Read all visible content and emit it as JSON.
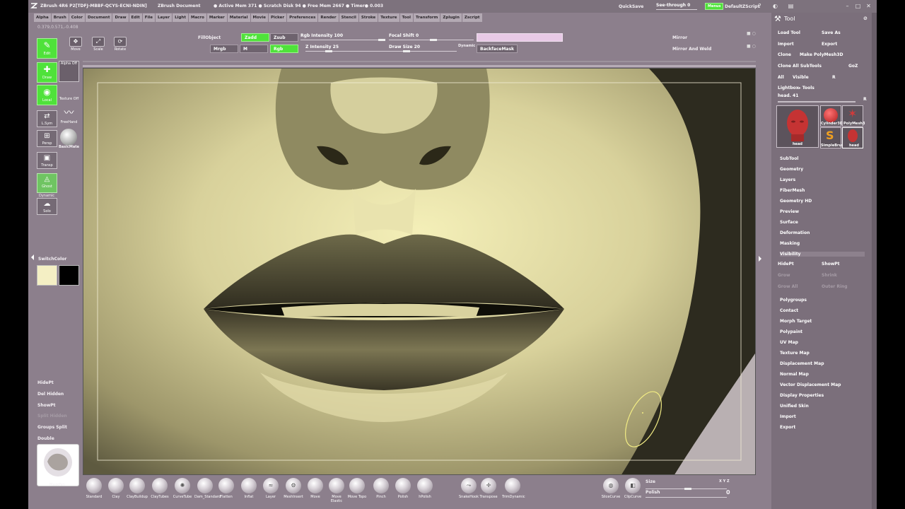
{
  "title": {
    "app": "ZBrush 4R6 P2[TDFJ-MBBF-QCYS-ECNI-NDIN]",
    "document": "ZBrush Document",
    "stats": "● Active Mem 371 ● Scratch Disk 94 ● Free Mem 2667 ● Timer● 0.003",
    "quicksave": "QuickSave",
    "see_through": "See-through  0",
    "menus_btn": "Menus",
    "default_script": "DefaultZScript"
  },
  "menu": [
    "Alpha",
    "Brush",
    "Color",
    "Document",
    "Draw",
    "Edit",
    "File",
    "Layer",
    "Light",
    "Macro",
    "Marker",
    "Material",
    "Movie",
    "Picker",
    "Preferences",
    "Render",
    "Stencil",
    "Stroke",
    "Texture",
    "Tool",
    "Transform",
    "Zplugin",
    "Zscript"
  ],
  "coords": "0.379,0.571,-0.408",
  "shelf": {
    "edit": "Edit",
    "move": "Move",
    "scale": "Scale",
    "rotate": "Rotate",
    "fill_object": "FillObject",
    "mrgb": "Mrgb",
    "m": "M",
    "rgb": "Rgb",
    "zadd": "Zadd",
    "zsub": "Zsub",
    "rgb_intensity": "Rgb Intensity 100",
    "z_intensity": "Z Intensity 25",
    "focal_shift": "Focal Shift 0",
    "draw_size": "Draw Size 20",
    "dynamic": "Dynamic",
    "backface_mask": "BackfaceMask",
    "mirror": "Mirror",
    "mirror_weld": "Mirror And Weld"
  },
  "left": {
    "draw": "Draw",
    "alpha_off": "Alpha Off",
    "texture_off": "Texture Off",
    "local": "Local",
    "lsym": "L.Sym",
    "freehand": "FreeHand",
    "persp": "Persp",
    "basic_material": "BasicMate",
    "floor": "Floor",
    "transp": "Transp",
    "ghost": "Ghost",
    "dynamic": "Dynamic",
    "solo": "Solo",
    "switch_color": "SwitchColor",
    "hidept": "HidePt",
    "del_hidden": "Del Hidden",
    "showpt": "ShowPt",
    "split_hidden": "Split Hidden",
    "groups_split": "Groups Split",
    "double": "Double",
    "mask_pen": "MaskPen",
    "primary_color": "#f4efc4",
    "secondary_color": "#000000"
  },
  "brushes": [
    "Standard",
    "Clay",
    "ClayBuildup",
    "ClayTubes",
    "CurveTube",
    "Dam_Standard",
    "Flatten",
    "Inflat",
    "Layer",
    "MeshInsert",
    "Move",
    "Move Elastic",
    "Move Topo",
    "Pinch",
    "Polish",
    "hPolish",
    "SnakeHook",
    "Transpose",
    "TrimDynamic",
    "SliceCurve",
    "ClipCurve"
  ],
  "bottom": {
    "size": "Size",
    "polish": "Polish",
    "xyz": "X Y Z",
    "zero": "0"
  },
  "tool": {
    "title": "Tool",
    "load_tool": "Load Tool",
    "save_as": "Save As",
    "import": "Import",
    "export": "Export",
    "clone": "Clone",
    "make_polymesh": "Make PolyMesh3D",
    "clone_all": "Clone All SubTools",
    "goz": "GoZ",
    "all": "All",
    "visible": "Visible",
    "r": "R",
    "lightbox": "Lightbox▸ Tools",
    "head_label": "head. 41",
    "r2": "R",
    "thumbs": [
      "head",
      "Cylinder3D",
      "PolyMesh3",
      "SimpleBrus",
      "head"
    ],
    "sections": [
      "SubTool",
      "Geometry",
      "Layers",
      "FiberMesh",
      "Geometry HD",
      "Preview",
      "Surface",
      "Deformation",
      "Masking",
      "Visibility"
    ],
    "vis_hidept": "HidePt",
    "vis_showpt": "ShowPt",
    "vis_grow": "Grow",
    "vis_shrink": "Shrink",
    "vis_grow_all": "Grow All",
    "vis_outer_ring": "Outer Ring",
    "sections2": [
      "Polygroups",
      "Contact",
      "Morph Target",
      "Polypaint",
      "UV Map",
      "Texture Map",
      "Displacement Map",
      "Normal Map",
      "Vector Displacement Map",
      "Display Properties",
      "Unified Skin",
      "Import",
      "Export"
    ]
  }
}
